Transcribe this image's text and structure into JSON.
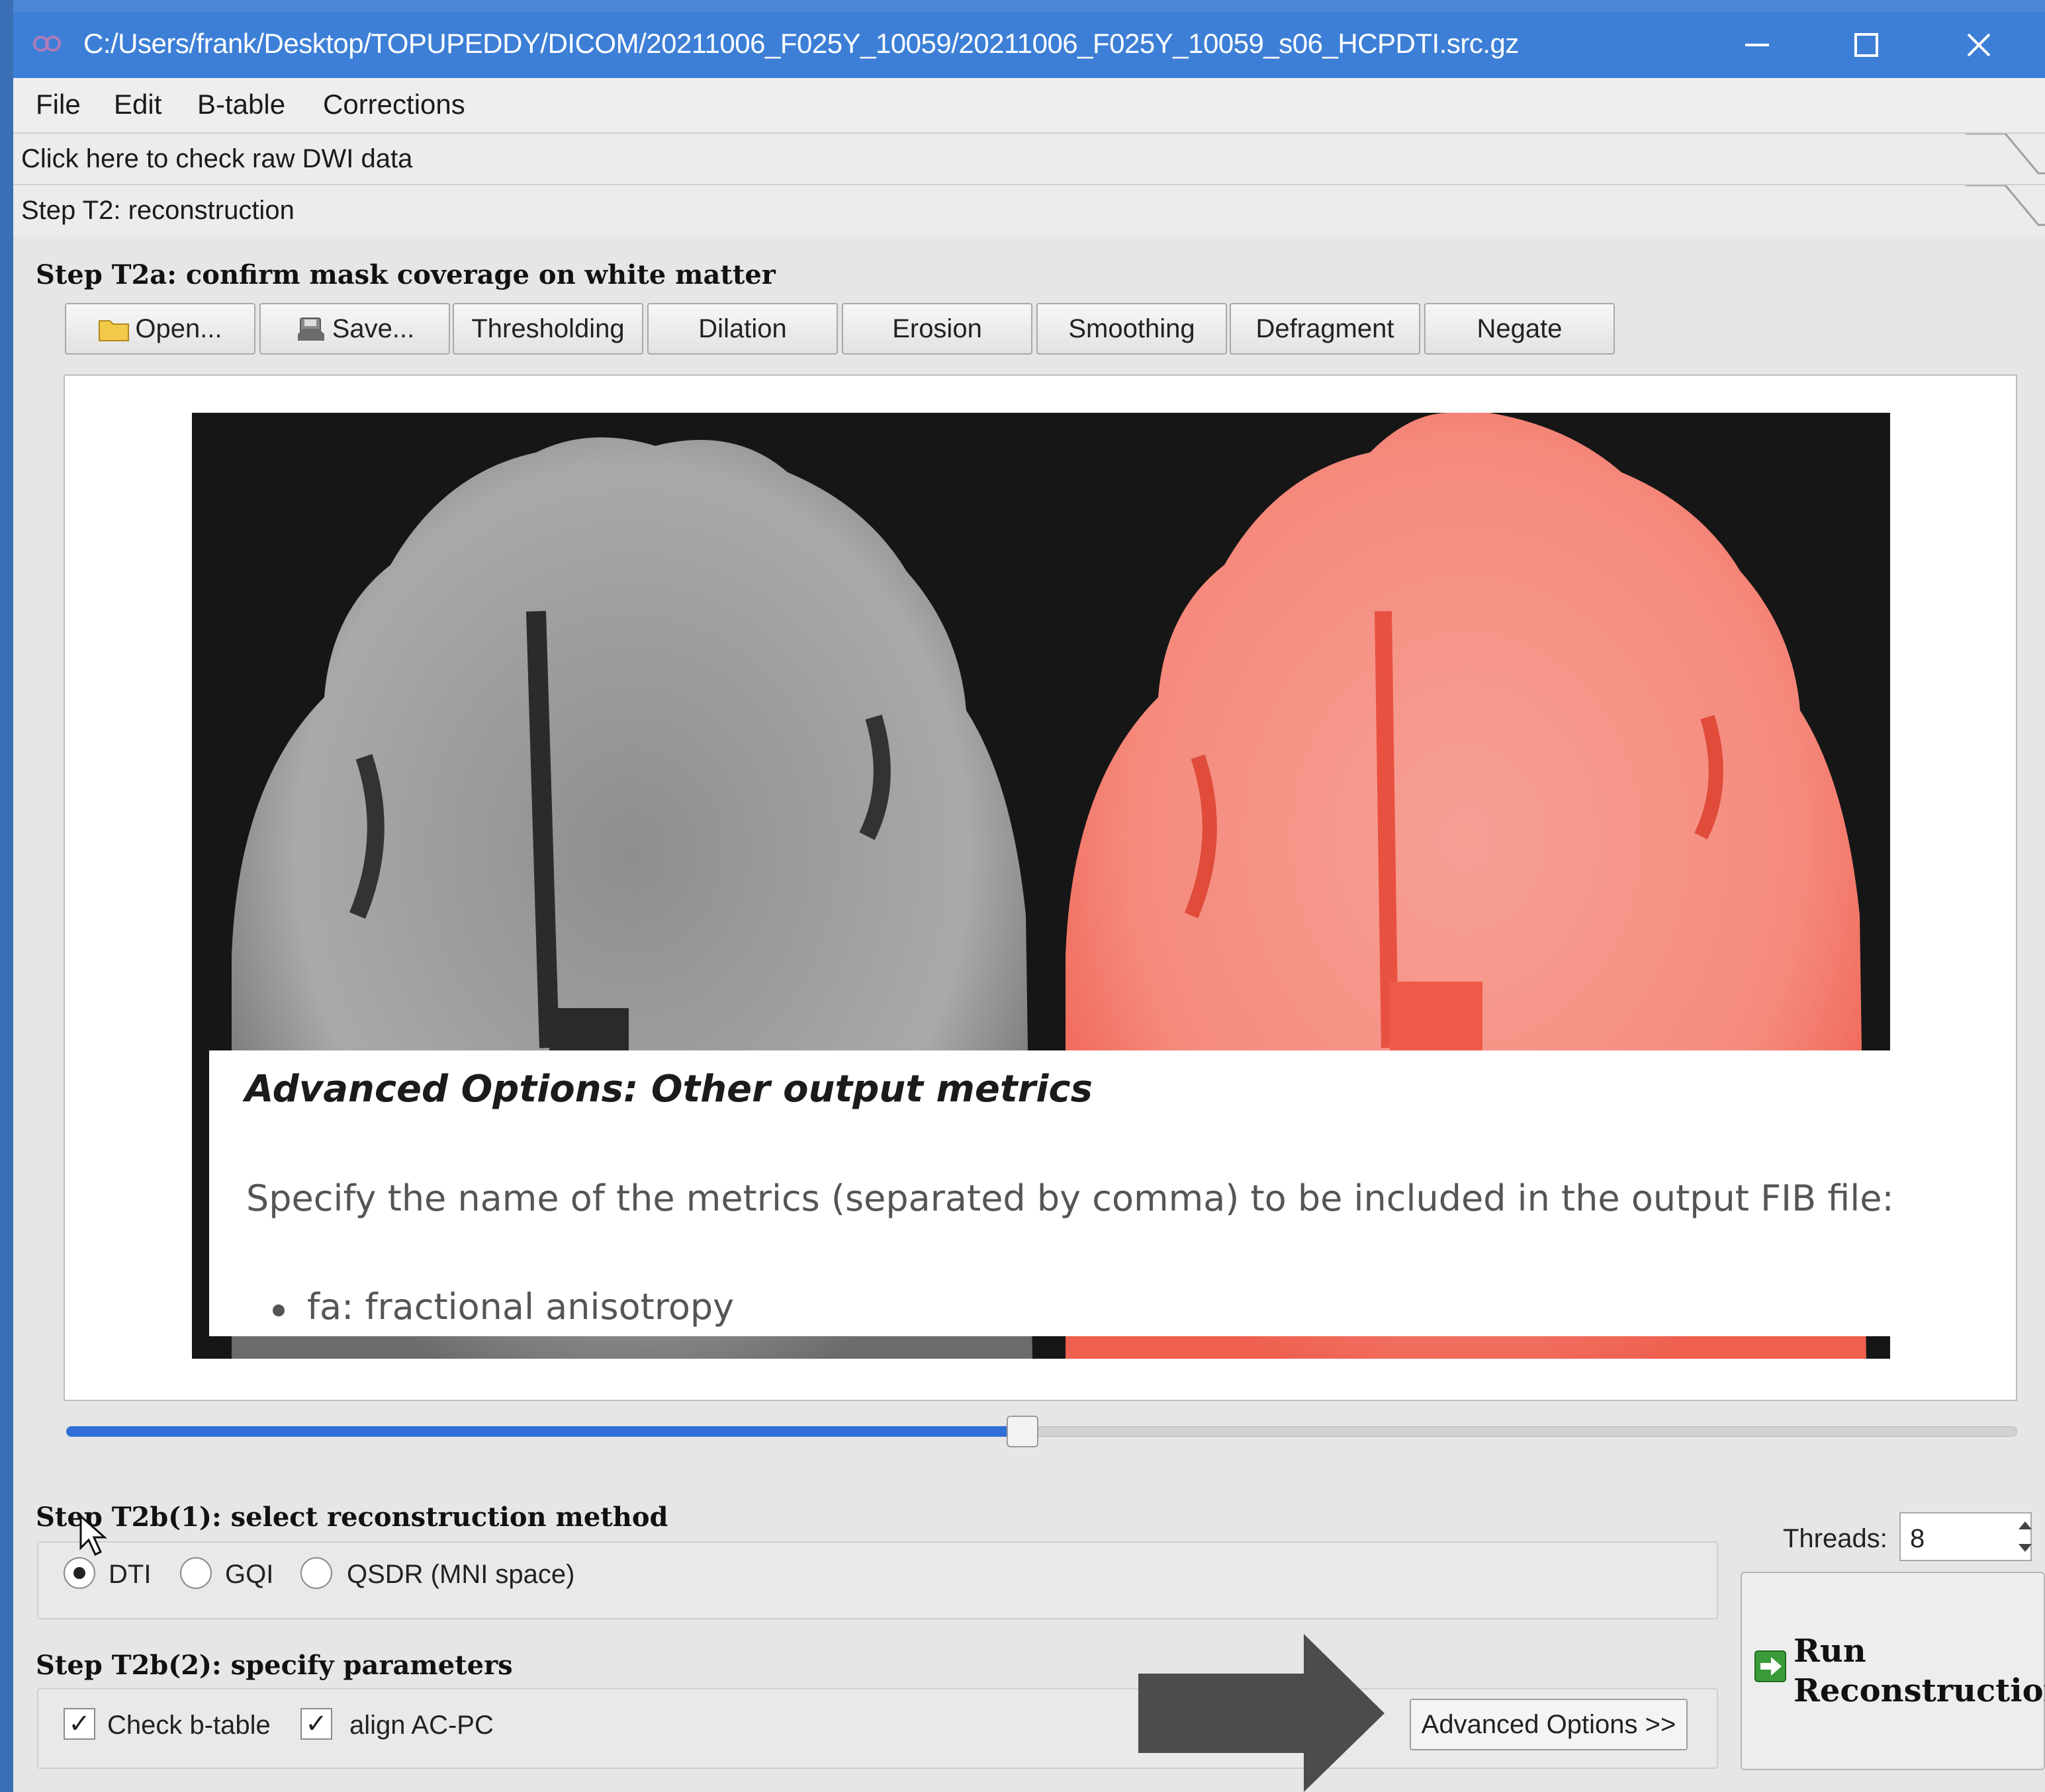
{
  "window": {
    "title": "C:/Users/frank/Desktop/TOPUPEDDY/DICOM/20211006_F025Y_10059/20211006_F025Y_10059_s06_HCPDTI.src.gz"
  },
  "menu": [
    "File",
    "Edit",
    "B-table",
    "Corrections"
  ],
  "toolbox": {
    "raw_dwi": "Click here to check raw DWI data",
    "step_t2": "Step T2: reconstruction"
  },
  "step_t2a": {
    "title": "Step T2a: confirm mask coverage on white matter",
    "buttons": [
      "Open...",
      "Save...",
      "Thresholding",
      "Dilation",
      "Erosion",
      "Smoothing",
      "Defragment",
      "Negate"
    ],
    "slice_position": 0.49
  },
  "overlay": {
    "title": "Advanced Options: Other output metrics",
    "description": "Specify the name of the metrics (separated by comma) to be included in the output FIB file:",
    "bullets": [
      "fa: fractional anisotropy"
    ]
  },
  "step_t2b1": {
    "title": "Step T2b(1): select reconstruction method",
    "options": [
      "DTI",
      "GQI",
      "QSDR (MNI space)"
    ],
    "selected": "DTI"
  },
  "threads": {
    "label": "Threads:",
    "value": "8"
  },
  "step_t2b2": {
    "title": "Step T2b(2): specify parameters",
    "checks": [
      {
        "label": "Check b-table",
        "checked": true
      },
      {
        "label": "align AC-PC",
        "checked": true
      }
    ],
    "advanced_label": "Advanced Options >>"
  },
  "run": {
    "line1": "Run",
    "line2": "Reconstruction"
  },
  "colors": {
    "titlebar": "#3d7fd6",
    "slider": "#2f6fd6",
    "mask": "#f26c5f"
  }
}
